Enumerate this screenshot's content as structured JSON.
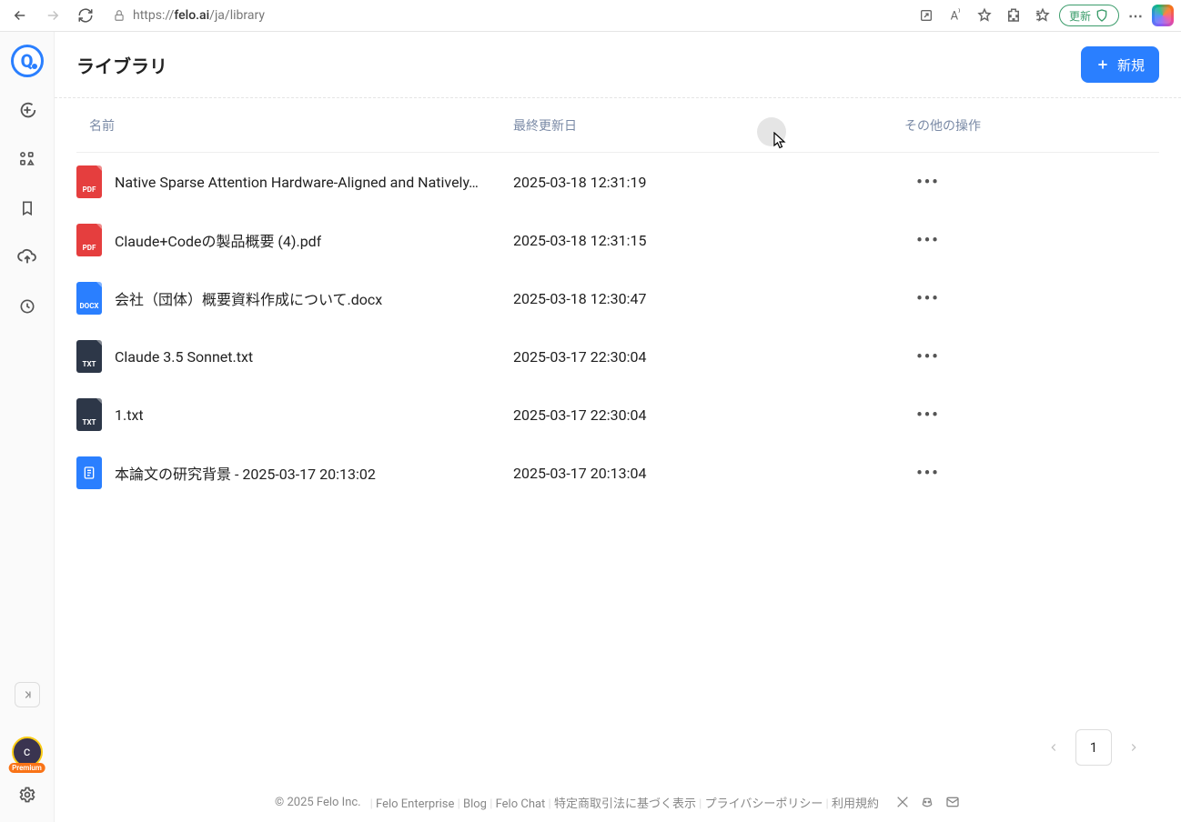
{
  "browser": {
    "url_prefix": "https://",
    "url_host": "felo.ai",
    "url_path": "/ja/library",
    "update_label": "更新"
  },
  "sidebar": {
    "avatar_letter": "c",
    "premium_label": "Premium"
  },
  "header": {
    "title": "ライブラリ",
    "new_button": "新規"
  },
  "columns": {
    "name": "名前",
    "updated": "最終更新日",
    "actions": "その他の操作"
  },
  "files": [
    {
      "type": "pdf",
      "icon_label": "PDF",
      "name": "Native Sparse Attention Hardware-Aligned and Natively…",
      "updated": "2025-03-18 12:31:19"
    },
    {
      "type": "pdf",
      "icon_label": "PDF",
      "name": "Claude+Codeの製品概要 (4).pdf",
      "updated": "2025-03-18 12:31:15"
    },
    {
      "type": "docx",
      "icon_label": "DOCX",
      "name": "会社（団体）概要資料作成について.docx",
      "updated": "2025-03-18 12:30:47"
    },
    {
      "type": "txt",
      "icon_label": "TXT",
      "name": "Claude 3.5 Sonnet.txt",
      "updated": "2025-03-17 22:30:04"
    },
    {
      "type": "txt",
      "icon_label": "TXT",
      "name": "1.txt",
      "updated": "2025-03-17 22:30:04"
    },
    {
      "type": "doc",
      "icon_label": "",
      "name": "本論文の研究背景 - 2025-03-17 20:13:02",
      "updated": "2025-03-17 20:13:04"
    }
  ],
  "pagination": {
    "current": "1"
  },
  "footer": {
    "copyright": "© 2025   Felo Inc.",
    "links": [
      "Felo Enterprise",
      "Blog",
      "Felo Chat",
      "特定商取引法に基づく表示",
      "プライバシーポリシー",
      "利用規約"
    ]
  }
}
